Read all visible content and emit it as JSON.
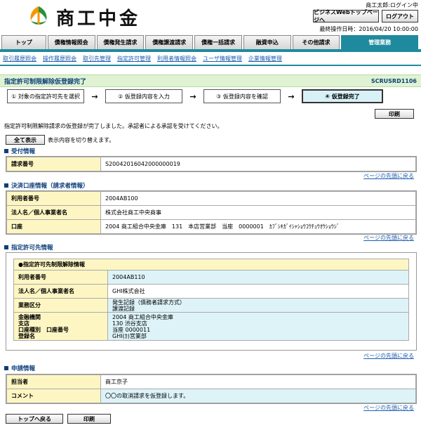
{
  "header": {
    "brand": "商工中金",
    "user_line": "商工太郎:ログイン中",
    "biz_top_button": "ビジネスWebトップページへ",
    "logout_button": "ログアウト",
    "last_operation": "最終操作日時：2016/04/20 10:00:00",
    "colors": {
      "logo_orange": "#f39800",
      "logo_green": "#2d8f3c"
    }
  },
  "tabs": [
    {
      "label": "トップ"
    },
    {
      "label": "債権情報照会"
    },
    {
      "label": "債権発生請求"
    },
    {
      "label": "債権譲渡請求"
    },
    {
      "label": "債権一括請求"
    },
    {
      "label": "融資申込"
    },
    {
      "label": "その他請求"
    },
    {
      "label": "管理業務"
    }
  ],
  "subnav": [
    "取引履歴照会",
    "操作履歴照会",
    "取引先管理",
    "指定許可管理",
    "利用者情報照会",
    "ユーザ情報管理",
    "企業情報管理"
  ],
  "page": {
    "title": "指定許可制限解除仮登録完了",
    "screen_code": "SCRUSRD1106",
    "accent_color": "#1f8a9e"
  },
  "steps": [
    "① 対象の指定許可先を選択",
    "② 仮登録内容を入力",
    "③ 仮登録内容を確認",
    "④ 仮登録完了"
  ],
  "print_label": "印刷",
  "message": "指定許可制限解除請求の仮登録が完了しました。承認者による承認を受けてください。",
  "show_all": {
    "button": "全て表示",
    "text": "表示内容を切り替えます。"
  },
  "page_top_link": "ページの先頭に戻る",
  "sections": {
    "receipt": {
      "title": "受付情報",
      "rows": [
        {
          "k": "請求番号",
          "v": "S20042016042000000019"
        }
      ]
    },
    "settlement": {
      "title": "決済口座情報（請求者情報）",
      "rows": [
        {
          "k": "利用者番号",
          "v": "2004AB100"
        },
        {
          "k": "法人名／個人事業者名",
          "v": "株式会社商工中央商事"
        },
        {
          "k": "口座",
          "v": "2004 商工組合中央金庫　131　本店営業部　当座　0000001　ｶﾌﾞｼｷｶﾞｲｼｬｼｮｳｺｳﾁｭｳｵｳｼｮｳｼﾞ"
        }
      ]
    },
    "permitted": {
      "title": "指定許可先情報",
      "inner_title": "●指定許可先制限解除情報",
      "user_no_k": "利用者番号",
      "user_no_v": "2004AB110",
      "name_k": "法人名／個人事業者名",
      "name_v": "GHI株式会社",
      "business_k": "業務区分",
      "business_v1": "発生記録（債務者請求方式）",
      "business_v2": "譲渡記録",
      "bank_k1": "金融機関",
      "bank_k2": "支店",
      "bank_k3": "口座種別　口座番号",
      "bank_k4": "登録名",
      "bank_v1": "2004 商工組合中央金庫",
      "bank_v2": "130 渋谷支店",
      "bank_v3": "当座 0000011",
      "bank_v4": "GHI(ｶ)営業部"
    },
    "application": {
      "title": "申請情報",
      "rows": [
        {
          "k": "担当者",
          "v": "商工京子"
        },
        {
          "k": "コメント",
          "v": "〇〇の取消請求を仮登録します。"
        }
      ]
    }
  },
  "footer": {
    "back_top": "トップへ戻る",
    "print": "印刷"
  }
}
